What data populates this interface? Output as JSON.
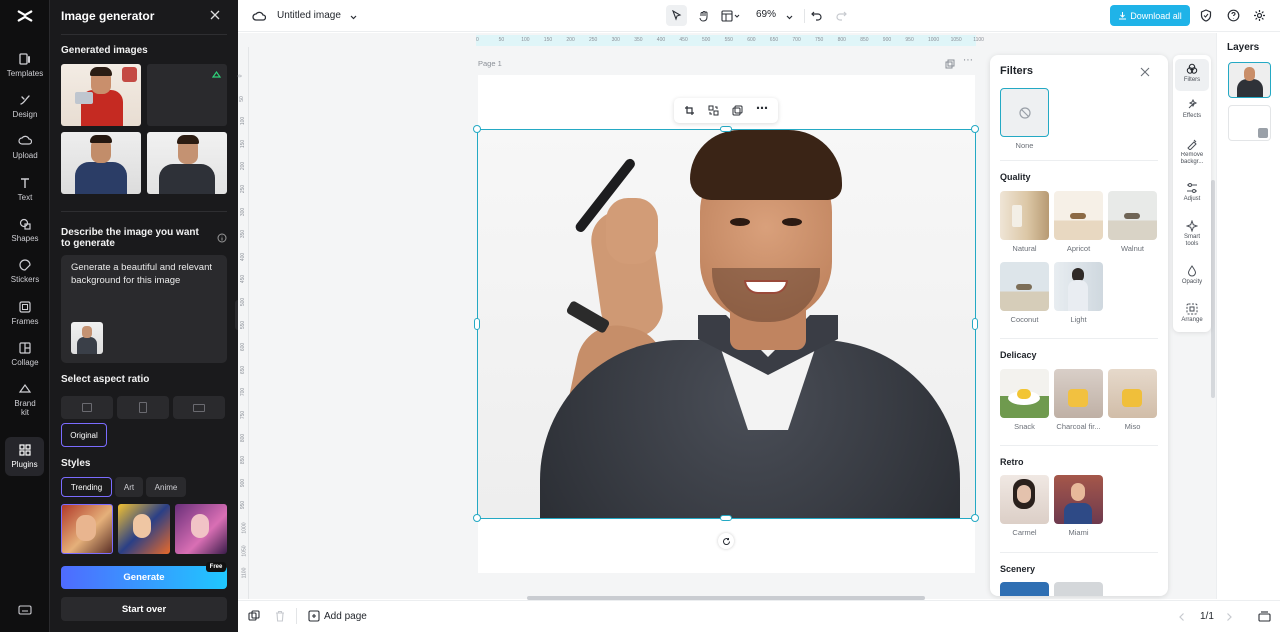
{
  "rail": {
    "items": [
      {
        "label": "Templates",
        "icon": "templates-icon"
      },
      {
        "label": "Design",
        "icon": "design-icon"
      },
      {
        "label": "Upload",
        "icon": "upload-icon"
      },
      {
        "label": "Text",
        "icon": "text-icon"
      },
      {
        "label": "Shapes",
        "icon": "shapes-icon"
      },
      {
        "label": "Stickers",
        "icon": "stickers-icon"
      },
      {
        "label": "Frames",
        "icon": "frames-icon"
      },
      {
        "label": "Collage",
        "icon": "collage-icon"
      },
      {
        "label": "Brand kit",
        "icon": "brand-kit-icon"
      },
      {
        "label": "Plugins",
        "icon": "plugins-icon"
      }
    ]
  },
  "panel": {
    "title": "Image generator",
    "generated_label": "Generated images",
    "describe_label": "Describe the image you want to generate",
    "prompt_text": "Generate a beautiful and relevant background for this image",
    "aspect_label": "Select aspect ratio",
    "aspect_selected": "Original",
    "styles_label": "Styles",
    "style_tabs": [
      "Trending",
      "Art",
      "Anime"
    ],
    "generate_label": "Generate",
    "free_badge": "Free",
    "start_over_label": "Start over"
  },
  "topbar": {
    "doc_title": "Untitled image",
    "zoom": "69%",
    "download_label": "Download all"
  },
  "canvas": {
    "page_label": "Page 1",
    "ruler_h": [
      "0",
      "50",
      "100",
      "150",
      "200",
      "250",
      "300",
      "350",
      "400",
      "450",
      "500",
      "550",
      "600",
      "650",
      "700",
      "750",
      "800",
      "850",
      "900",
      "950",
      "1000",
      "1050",
      "1100"
    ],
    "ruler_v": [
      "0",
      "50",
      "100",
      "150",
      "200",
      "250",
      "300",
      "350",
      "400",
      "450",
      "500",
      "550",
      "600",
      "650",
      "700",
      "750",
      "800",
      "850",
      "900",
      "950",
      "1000",
      "1050",
      "1100"
    ]
  },
  "filters": {
    "title": "Filters",
    "none_label": "None",
    "categories": [
      {
        "name": "Quality",
        "items": [
          "Natural",
          "Apricot",
          "Walnut",
          "Coconut",
          "Light"
        ]
      },
      {
        "name": "Delicacy",
        "items": [
          "Snack",
          "Charcoal fir...",
          "Miso"
        ]
      },
      {
        "name": "Retro",
        "items": [
          "Carmel",
          "Miami"
        ]
      },
      {
        "name": "Scenery",
        "items": []
      }
    ]
  },
  "tools": [
    {
      "label": "Filters",
      "icon": "filters-icon"
    },
    {
      "label": "Effects",
      "icon": "effects-icon"
    },
    {
      "label": "Remove backgr...",
      "icon": "remove-background-icon"
    },
    {
      "label": "Adjust",
      "icon": "adjust-icon"
    },
    {
      "label": "Smart tools",
      "icon": "smart-tools-icon"
    },
    {
      "label": "Opacity",
      "icon": "opacity-icon"
    },
    {
      "label": "Arrange",
      "icon": "arrange-icon"
    }
  ],
  "layers": {
    "title": "Layers"
  },
  "bottom": {
    "add_page_label": "Add page",
    "page_count": "1/1"
  },
  "colors": {
    "accent": "#24a9c4",
    "download": "#1fb3e8",
    "generate_start": "#4f6bff",
    "generate_end": "#1fc8ff"
  }
}
